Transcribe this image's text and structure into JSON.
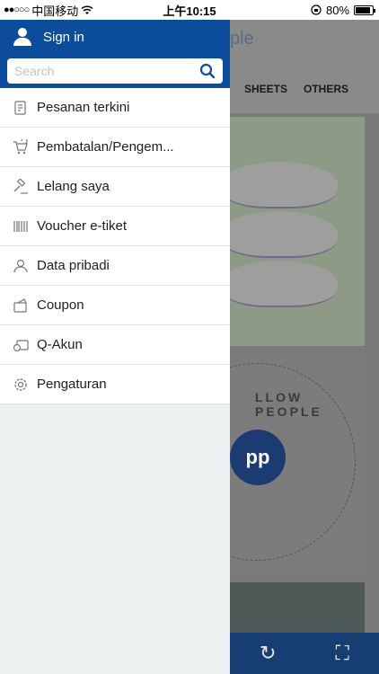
{
  "status_bar": {
    "carrier": "中国移动",
    "time": "上午10:15",
    "battery": "80%"
  },
  "background": {
    "brand_fragment": "ple",
    "tabs": [
      "SHEETS",
      "OTHERS"
    ],
    "badge_logo_text": "pp",
    "badge_ring_text": "QUALITY BEDDING GOODS WITH AFFORDABLE PILLOW PEOPLE"
  },
  "drawer": {
    "signin_label": "Sign in",
    "search_placeholder": "Search",
    "items": [
      {
        "label": "Pesanan terkini",
        "icon": "order-document-icon"
      },
      {
        "label": "Pembatalan/Pengem...",
        "icon": "cart-return-icon"
      },
      {
        "label": "Lelang saya",
        "icon": "auction-hammer-icon"
      },
      {
        "label": "Voucher e-tiket",
        "icon": "barcode-icon"
      },
      {
        "label": "Data pribadi",
        "icon": "person-icon"
      },
      {
        "label": "Coupon",
        "icon": "coupon-folder-icon"
      },
      {
        "label": "Q-Akun",
        "icon": "wallet-icon"
      },
      {
        "label": "Pengaturan",
        "icon": "gear-icon"
      }
    ]
  },
  "bottom_bar_icons": [
    "refresh-icon",
    "scan-icon"
  ]
}
